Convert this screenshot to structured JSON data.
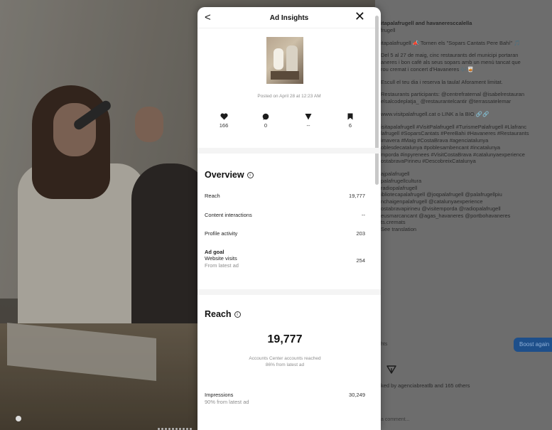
{
  "modal": {
    "title": "Ad Insights",
    "back_icon": "chevron-left-icon",
    "close_icon": "close-icon",
    "posted_text": "Posted on April 28 at 12:23 AM",
    "stats": [
      {
        "icon": "heart-icon",
        "value": "166"
      },
      {
        "icon": "comment-icon",
        "value": "0"
      },
      {
        "icon": "share-icon",
        "value": "--"
      },
      {
        "icon": "bookmark-icon",
        "value": "6"
      }
    ],
    "overview": {
      "title": "Overview",
      "reach_label": "Reach",
      "reach_value": "19,777",
      "content_interactions_label": "Content interactions",
      "content_interactions_value": "--",
      "profile_activity_label": "Profile activity",
      "profile_activity_value": "203",
      "ad_goal_label": "Ad goal",
      "ad_goal_metric": "Website visits",
      "ad_goal_sub": "From latest ad",
      "ad_goal_value": "254"
    },
    "reach": {
      "title": "Reach",
      "value": "19,777",
      "desc_line1": "Accounts Center accounts reached",
      "desc_line2": "86% from latest ad",
      "impressions_label": "Impressions",
      "impressions_sub": "90% from latest ad",
      "impressions_value": "30,249"
    }
  },
  "caption": {
    "lines": [
      {
        "text": "itapalafrugell and havaneresccalella",
        "bold": true
      },
      {
        "text": "frugell",
        "bold": false
      },
      {
        "text": "",
        "bold": false
      },
      {
        "text": "itapalafrugell 📣 Tornen els \"Sopars Cantats Pere Bahí\" 🎵",
        "bold": false
      },
      {
        "text": "",
        "bold": false
      },
      {
        "text": "Del 5 al 27 de maig, cinc restaurants del municipi portaran",
        "bold": false
      },
      {
        "text": "aneres i bon cafè als seus sopars amb un menú tancat que",
        "bold": false
      },
      {
        "text": "rou cremat i concert d'Havaneres 🎶🥃",
        "bold": false
      },
      {
        "text": "",
        "bold": false
      },
      {
        "text": "Escull el teu dia i reserva la taula! Aforament limitat.",
        "bold": false
      },
      {
        "text": "",
        "bold": false
      },
      {
        "text": "Restaurants participants: @centrefraternal @isabelrestauran",
        "bold": false
      },
      {
        "text": "elsalcodeplatja_ @restaurantelcantir @terrassatelemar",
        "bold": false
      },
      {
        "text": "",
        "bold": false
      },
      {
        "text": "www.visitpalafrugell.cat o LINK a la BIO 🔗🔗",
        "bold": false
      },
      {
        "text": "",
        "bold": false
      },
      {
        "text": "isitapalafrugell #VisitPalafrugell #TurismePalafrugell #Llafranc",
        "bold": false
      },
      {
        "text": "lafrugell #SoparsCantats #PereBahi #Havaneres #Restaurants",
        "bold": false
      },
      {
        "text": "imavera #Maig #CostaBrava #agenciatalunya",
        "bold": false
      },
      {
        "text": "oblesdecatalunya #poblesambencant #incatalunya",
        "bold": false
      },
      {
        "text": "mporda #inpyrenees #VisitCostaBrava #catalunyaexperience",
        "bold": false
      },
      {
        "text": "ostabravaPirineu #DescobreixCatalunya",
        "bold": false
      },
      {
        "text": "",
        "bold": false
      },
      {
        "text": "ajpalafrugell",
        "bold": false
      },
      {
        "text": "palafrugellcultura",
        "bold": false
      },
      {
        "text": "radiopalafrugell",
        "bold": false
      },
      {
        "text": "ibliotecapalafrugell @joqpalafrugell @palafrugellpiu",
        "bold": false
      },
      {
        "text": "nchaigenpalafrugell @catalunyaexperience",
        "bold": false
      },
      {
        "text": "ostabravapirineu @visitemporda @radiopalafrugell",
        "bold": false
      },
      {
        "text": "eusmarcancant @agas_havaneres @portbohavaneres",
        "bold": false
      },
      {
        "text": "ts.cremats",
        "bold": false
      },
      {
        "text": "See translation",
        "bold": false
      }
    ],
    "insights_link": "hts",
    "boost_button": "Boost again",
    "liked_text": "ked by agenciabreatlb and 165 others",
    "comment_placeholder": "a comment..."
  }
}
